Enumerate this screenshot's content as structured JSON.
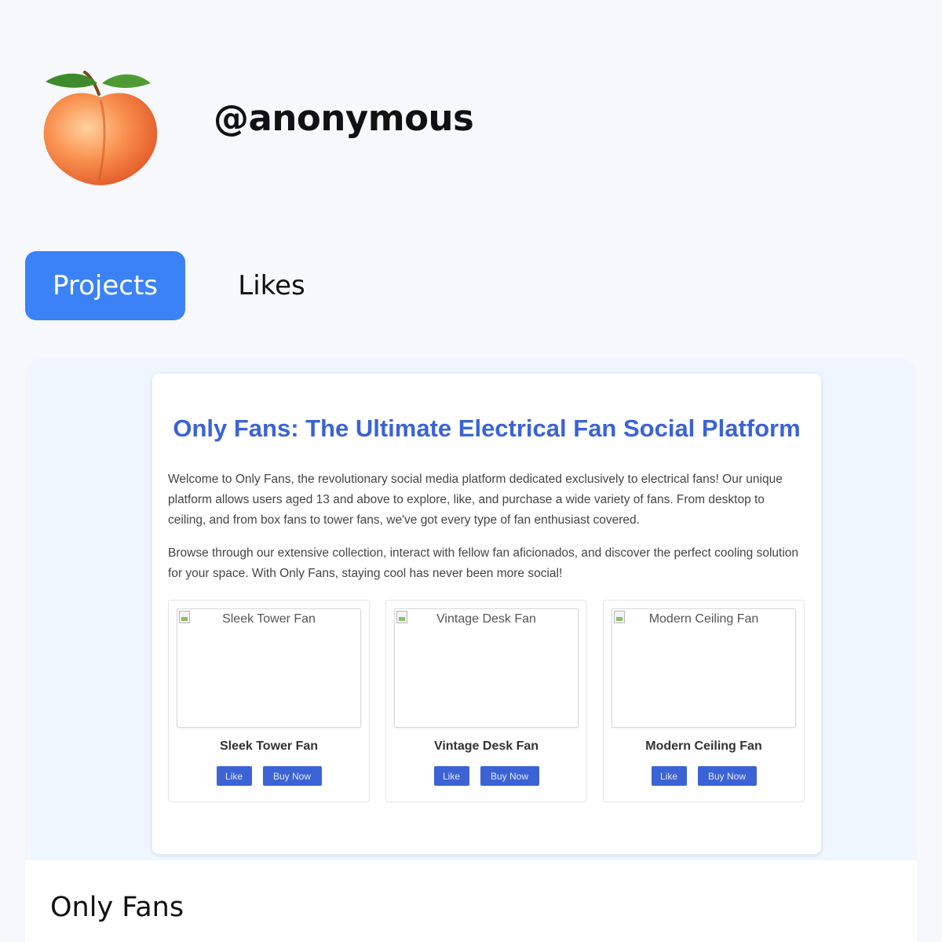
{
  "profile": {
    "avatar_icon": "peach-emoji",
    "username": "@anonymous"
  },
  "tabs": [
    {
      "label": "Projects",
      "active": true
    },
    {
      "label": "Likes",
      "active": false
    }
  ],
  "project": {
    "name": "Only Fans",
    "preview": {
      "title": "Only Fans: The Ultimate Electrical Fan Social Platform",
      "paragraphs": [
        "Welcome to Only Fans, the revolutionary social media platform dedicated exclusively to electrical fans! Our unique platform allows users aged 13 and above to explore, like, and purchase a wide variety of fans. From desktop to ceiling, and from box fans to tower fans, we've got every type of fan enthusiast covered.",
        "Browse through our extensive collection, interact with fellow fan aficionados, and discover the perfect cooling solution for your space. With Only Fans, staying cool has never been more social!"
      ],
      "products": [
        {
          "image_alt": "Sleek Tower Fan",
          "name": "Sleek Tower Fan",
          "like_label": "Like",
          "buy_label": "Buy Now"
        },
        {
          "image_alt": "Vintage Desk Fan",
          "name": "Vintage Desk Fan",
          "like_label": "Like",
          "buy_label": "Buy Now"
        },
        {
          "image_alt": "Modern Ceiling Fan",
          "name": "Modern Ceiling Fan",
          "like_label": "Like",
          "buy_label": "Buy Now"
        }
      ]
    }
  },
  "colors": {
    "accent": "#3b82f6",
    "title_blue": "#3b63d6",
    "preview_bg": "#eff6ff"
  }
}
